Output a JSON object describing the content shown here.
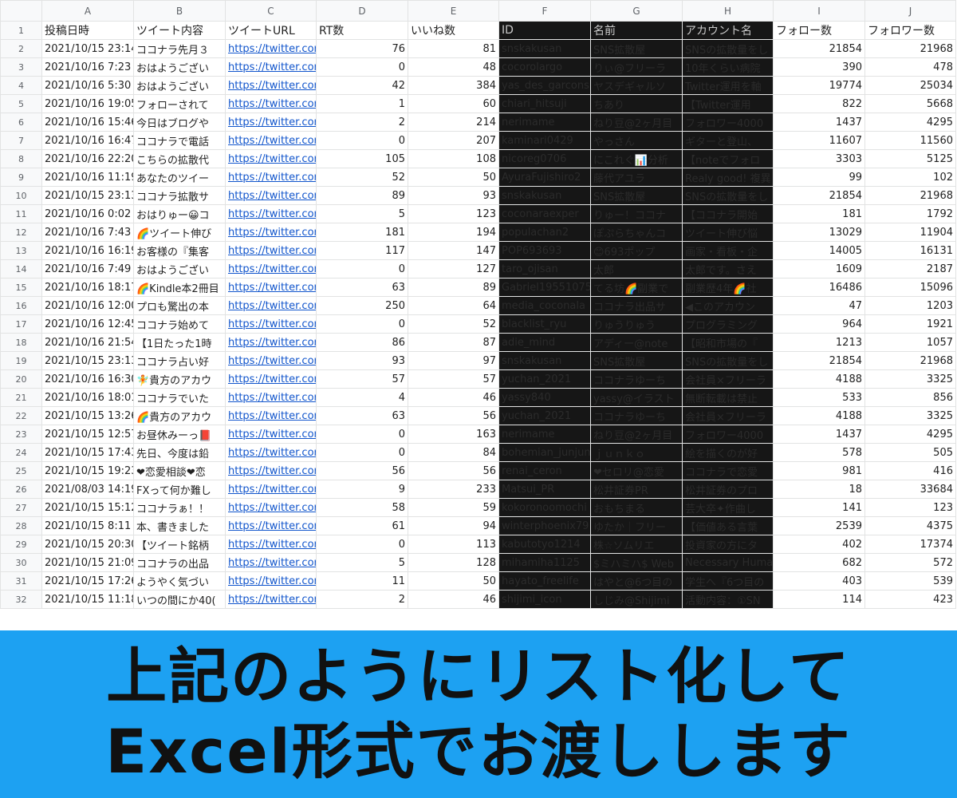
{
  "column_letters": [
    "A",
    "B",
    "C",
    "D",
    "E",
    "F",
    "G",
    "H",
    "I",
    "J"
  ],
  "header_row": [
    "投稿日時",
    "ツイート内容",
    "ツイートURL",
    "RT数",
    "いいね数",
    "ID",
    "名前",
    "アカウント名",
    "フォロー数",
    "フォロワー数"
  ],
  "rows": [
    [
      "2021/10/15 23:14",
      "ココナラ先月３",
      "https://twitter.cor",
      "76",
      "81",
      "snskakusan",
      "SNS拡散屋",
      "SNSの拡散量をし",
      "21854",
      "21968"
    ],
    [
      "2021/10/16 7:23",
      "おはようござい　",
      "https://twitter.cor",
      "0",
      "48",
      "cocorolargo",
      "りぃ@フリーラ",
      "10年くらい病院",
      "390",
      "478"
    ],
    [
      "2021/10/16 5:30",
      "おはようござい　",
      "https://twitter.cor",
      "42",
      "384",
      "yas_des_garcons",
      "ヤスデギャルソ",
      "Twitter運用を軸",
      "19774",
      "25034"
    ],
    [
      "2021/10/16 19:05",
      "フォローされて　",
      "https://twitter.cor",
      "1",
      "60",
      "chiari_hitsuji",
      "ちあり",
      "【Twitter運用",
      "822",
      "5668"
    ],
    [
      "2021/10/16 15:46",
      "今日はブログや　",
      "https://twitter.cor",
      "2",
      "214",
      "nerimame",
      "ねり豆@2ヶ月目",
      "フォロワー4000",
      "1437",
      "4295"
    ],
    [
      "2021/10/16 16:47",
      "ココナラで電話　",
      "https://twitter.cor",
      "0",
      "207",
      "kaminari0429",
      "やっさん",
      "ギターと登山、",
      "11607",
      "11560"
    ],
    [
      "2021/10/16 22:20",
      "こちらの拡散代　",
      "https://twitter.cor",
      "105",
      "108",
      "nicoreg0706",
      "にこれぐ📊分析",
      "【noteでフォロ",
      "3303",
      "5125"
    ],
    [
      "2021/10/16 11:19",
      "あなたのツイー",
      "https://twitter.cor",
      "52",
      "50",
      "AyuraFujishiro2",
      "藤代アユラ",
      "Realy good! 複異",
      "99",
      "102"
    ],
    [
      "2021/10/15 23:13",
      "ココナラ拡散サ　",
      "https://twitter.cor",
      "89",
      "93",
      "snskakusan",
      "SNS拡散屋",
      "SNSの拡散量をし",
      "21854",
      "21968"
    ],
    [
      "2021/10/16 0:02",
      "おはりゅー😀コ",
      "https://twitter.cor",
      "5",
      "123",
      "coconaraexper",
      "りゅー！ココナ",
      "【ココナラ開始",
      "181",
      "1792"
    ],
    [
      "2021/10/16 7:43",
      "🌈ツイート伸び",
      "https://twitter.cor",
      "181",
      "194",
      "populachan2",
      "ぽぷらちゃんコ",
      "ツイート伸び悩",
      "13029",
      "11904"
    ],
    [
      "2021/10/16 16:19",
      "お客様の『集客",
      "https://twitter.cor",
      "117",
      "147",
      "POP693693",
      "😊693ポップ",
      "画家・看板・企",
      "14005",
      "16131"
    ],
    [
      "2021/10/16 7:49",
      "おはようござい　",
      "https://twitter.cor",
      "0",
      "127",
      "taro_ojisan",
      "太郎",
      "太郎です。さえ",
      "1609",
      "2187"
    ],
    [
      "2021/10/16 18:17",
      "🌈Kindle本2冊目",
      "https://twitter.cor",
      "63",
      "89",
      "Gabriel19551075",
      "てる坊🌈副業で",
      "副業歴4年🌈社",
      "16486",
      "15096"
    ],
    [
      "2021/10/16 12:00",
      "プロも驚出の本",
      "https://twitter.cor",
      "250",
      "64",
      "media_coconala",
      "ココナラ出品サ",
      "◀このアカウン",
      "47",
      "1203"
    ],
    [
      "2021/10/16 12:45",
      "ココナラ始めて　",
      "https://twitter.cor",
      "0",
      "52",
      "blacklist_ryu",
      "りゅうりゅう",
      "プログラミング",
      "964",
      "1921"
    ],
    [
      "2021/10/16 21:54",
      "【1日たった1時",
      "https://twitter.cor",
      "86",
      "87",
      "adie_mind",
      "アディー@note",
      "【昭和市場の『",
      "1213",
      "1057"
    ],
    [
      "2021/10/15 23:13",
      "ココナラ占い好",
      "https://twitter.cor",
      "93",
      "97",
      "snskakusan",
      "SNS拡散屋",
      "SNSの拡散量をし",
      "21854",
      "21968"
    ],
    [
      "2021/10/16 16:30",
      "🧚貴方のアカウ",
      "https://twitter.cor",
      "57",
      "57",
      "yuchan_2021",
      "ココナラゆーち",
      "会社員×フリーラ",
      "4188",
      "3325"
    ],
    [
      "2021/10/16 18:01",
      "ココナラでいた　",
      "https://twitter.cor",
      "4",
      "46",
      "yassy840",
      "yassy@イラスト",
      "無断転載は禁止",
      "533",
      "856"
    ],
    [
      "2021/10/15 13:26",
      "🌈貴方のアカウ",
      "https://twitter.cor",
      "63",
      "56",
      "yuchan_2021",
      "ココナラゆーち",
      "会社員×フリーラ",
      "4188",
      "3325"
    ],
    [
      "2021/10/15 12:57",
      "お昼休みーっ📕",
      "https://twitter.cor",
      "0",
      "163",
      "nerimame",
      "ねり豆@2ヶ月目",
      "フォロワー4000",
      "1437",
      "4295"
    ],
    [
      "2021/10/15 17:43",
      "先日、今度は鉛　",
      "https://twitter.cor",
      "0",
      "84",
      "bohemian_junjun",
      "ｊｕｎｋｏ",
      "絵を描くのが好",
      "578",
      "505"
    ],
    [
      "2021/10/15 19:23",
      "❤恋愛相談❤恋　",
      "https://twitter.cor",
      "56",
      "56",
      "renai_ceron",
      "❤セロリ@恋愛",
      "ココナラで恋愛",
      "981",
      "416"
    ],
    [
      "2021/08/03 14:19",
      "FXって何か難し",
      "https://twitter.cor",
      "9",
      "233",
      "Matsui_PR",
      "松井証券PR",
      "松井証券のプロ",
      "18",
      "33684"
    ],
    [
      "2021/10/15 15:12",
      "ココナラぁ！！　",
      "https://twitter.cor",
      "58",
      "59",
      "kokoronoomochi",
      "おもちまる",
      "芸大卒✦作曲し",
      "141",
      "123"
    ],
    [
      "2021/10/15 8:11",
      "本、書きました　",
      "https://twitter.cor",
      "61",
      "94",
      "winterphoenix79",
      "ゆたか｜フリー",
      "【価値ある言葉",
      "2539",
      "4375"
    ],
    [
      "2021/10/15 20:30",
      "【ツイート銘柄　",
      "https://twitter.cor",
      "0",
      "113",
      "kabutotyo1214",
      "株☆ソムリエ",
      "投資家の方にタ",
      "402",
      "17374"
    ],
    [
      "2021/10/15 21:09",
      "ココナラの出品",
      "https://twitter.cor",
      "5",
      "128",
      "mihamiha1125",
      "$ミハミハ$ Web",
      "Necessary Human",
      "682",
      "572"
    ],
    [
      "2021/10/15 17:26",
      "ようやく気づい　",
      "https://twitter.cor",
      "11",
      "50",
      "hayato_freelife",
      "はやと@6つ目の",
      "学生へ『6つ目の",
      "403",
      "539"
    ],
    [
      "2021/10/15 11:18",
      "いつの間にか40(",
      "https://twitter.cor",
      "2",
      "46",
      "shijimi_icon",
      "しじみ@Shijimi",
      "活動内容：①SN",
      "114",
      "423"
    ]
  ],
  "banner": {
    "line1": "上記のようにリスト化して",
    "line2": "Excel形式でお渡しします"
  },
  "colors": {
    "banner_bg": "#1da1f2",
    "redaction": "#161616",
    "link": "#1155cc"
  }
}
